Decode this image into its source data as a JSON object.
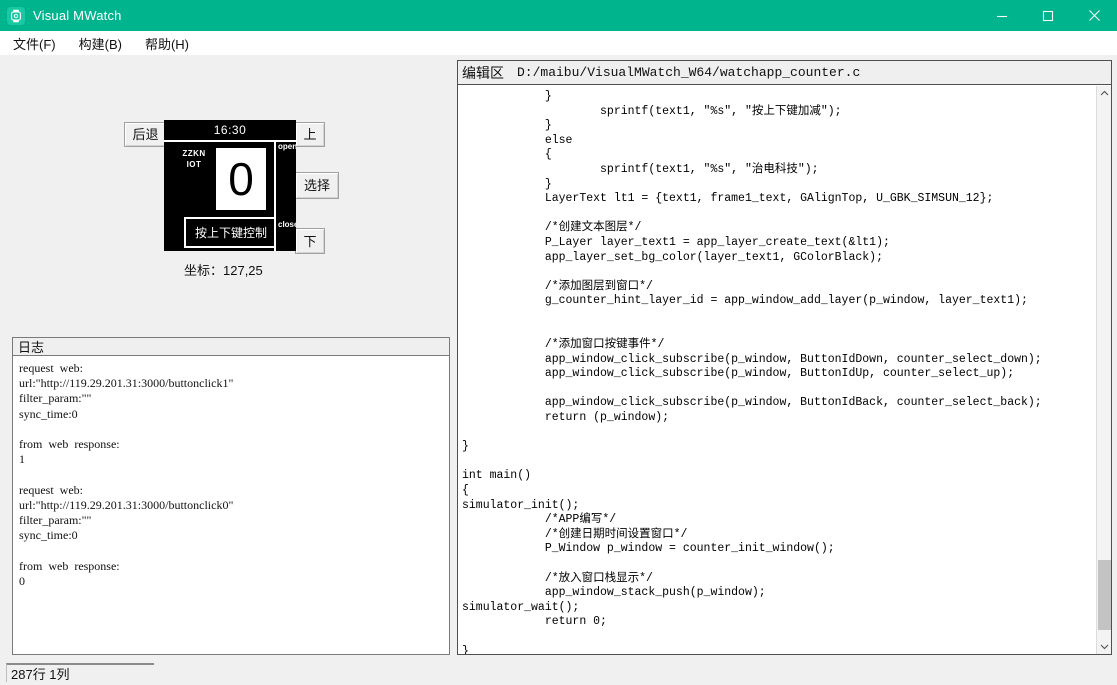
{
  "window": {
    "title": "Visual MWatch",
    "icon": "watch-icon",
    "titlebar_color": "#00b48e",
    "controls": {
      "minimize": "minimize-icon",
      "maximize": "maximize-icon",
      "close": "close-icon"
    }
  },
  "menubar": {
    "items": [
      {
        "label": "文件(F)"
      },
      {
        "label": "构建(B)"
      },
      {
        "label": "帮助(H)"
      }
    ]
  },
  "simulator": {
    "buttons": {
      "back": "后退",
      "up": "上",
      "select": "选择",
      "down": "下"
    },
    "watch": {
      "time": "16:30",
      "brand_line1": "ZZKN",
      "brand_line2": "IOT",
      "counter_value": "0",
      "hint": "按上下键控制",
      "label_open": "open",
      "label_close": "close",
      "screen_bg": "#000000",
      "screen_fg": "#ffffff"
    },
    "coordinates_label": "坐标：127,25"
  },
  "log": {
    "title": "日志",
    "content": "request  web:\nurl:\"http://119.29.201.31:3000/buttonclick1\"\nfilter_param:\"\"\nsync_time:0\n\nfrom  web  response:\n1\n\nrequest  web:\nurl:\"http://119.29.201.31:3000/buttonclick0\"\nfilter_param:\"\"\nsync_time:0\n\nfrom  web  response:\n0"
  },
  "editor": {
    "label": "编辑区",
    "path": "D:/maibu/VisualMWatch_W64/watchapp_counter.c",
    "code": "            }\n                    sprintf(text1, \"%s\", \"按上下键加减\");\n            }\n            else\n            {\n                    sprintf(text1, \"%s\", \"治电科技\");\n            }\n            LayerText lt1 = {text1, frame1_text, GAlignTop, U_GBK_SIMSUN_12};\n\n            /*创建文本图层*/\n            P_Layer layer_text1 = app_layer_create_text(&lt1);\n            app_layer_set_bg_color(layer_text1, GColorBlack);\n\n            /*添加图层到窗口*/\n            g_counter_hint_layer_id = app_window_add_layer(p_window, layer_text1);\n\n\n            /*添加窗口按键事件*/\n            app_window_click_subscribe(p_window, ButtonIdDown, counter_select_down);\n            app_window_click_subscribe(p_window, ButtonIdUp, counter_select_up);\n\n            app_window_click_subscribe(p_window, ButtonIdBack, counter_select_back);\n            return (p_window);\n\n}\n\nint main()\n{\nsimulator_init();\n            /*APP编写*/\n            /*创建日期时间设置窗口*/\n            P_Window p_window = counter_init_window();\n\n            /*放入窗口栈显示*/\n            app_window_stack_push(p_window);\nsimulator_wait();\n            return 0;\n\n}",
    "scrollbar": {
      "up_arrow": "chevron-up-icon",
      "down_arrow": "chevron-down-icon"
    }
  },
  "statusbar": {
    "position": "287行 1列"
  }
}
